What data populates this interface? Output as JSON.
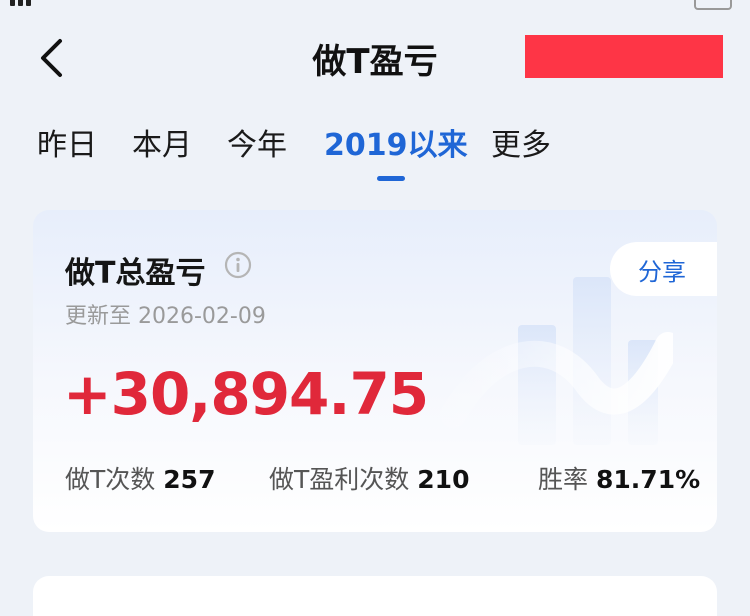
{
  "header": {
    "title": "做T盈亏",
    "back_icon": "chevron-left-icon",
    "redaction_color": "#fe3546"
  },
  "tabs": [
    {
      "label": "昨日",
      "active": false
    },
    {
      "label": "本月",
      "active": false
    },
    {
      "label": "今年",
      "active": false
    },
    {
      "label": "2019以来",
      "active": true
    },
    {
      "label": "更多",
      "active": false
    }
  ],
  "summary": {
    "title": "做T总盈亏",
    "info_icon": "info-icon",
    "updated": "更新至 2026-02-09",
    "share_label": "分享",
    "total_profit": "+30,894.75",
    "stats": [
      {
        "label": "做T次数",
        "value": "257"
      },
      {
        "label": "做T盈利次数",
        "value": "210"
      },
      {
        "label": "胜率",
        "value": "81.71%"
      }
    ]
  },
  "colors": {
    "accent": "#1f66d6",
    "profit": "#e0283a",
    "background": "#eef2f8"
  }
}
